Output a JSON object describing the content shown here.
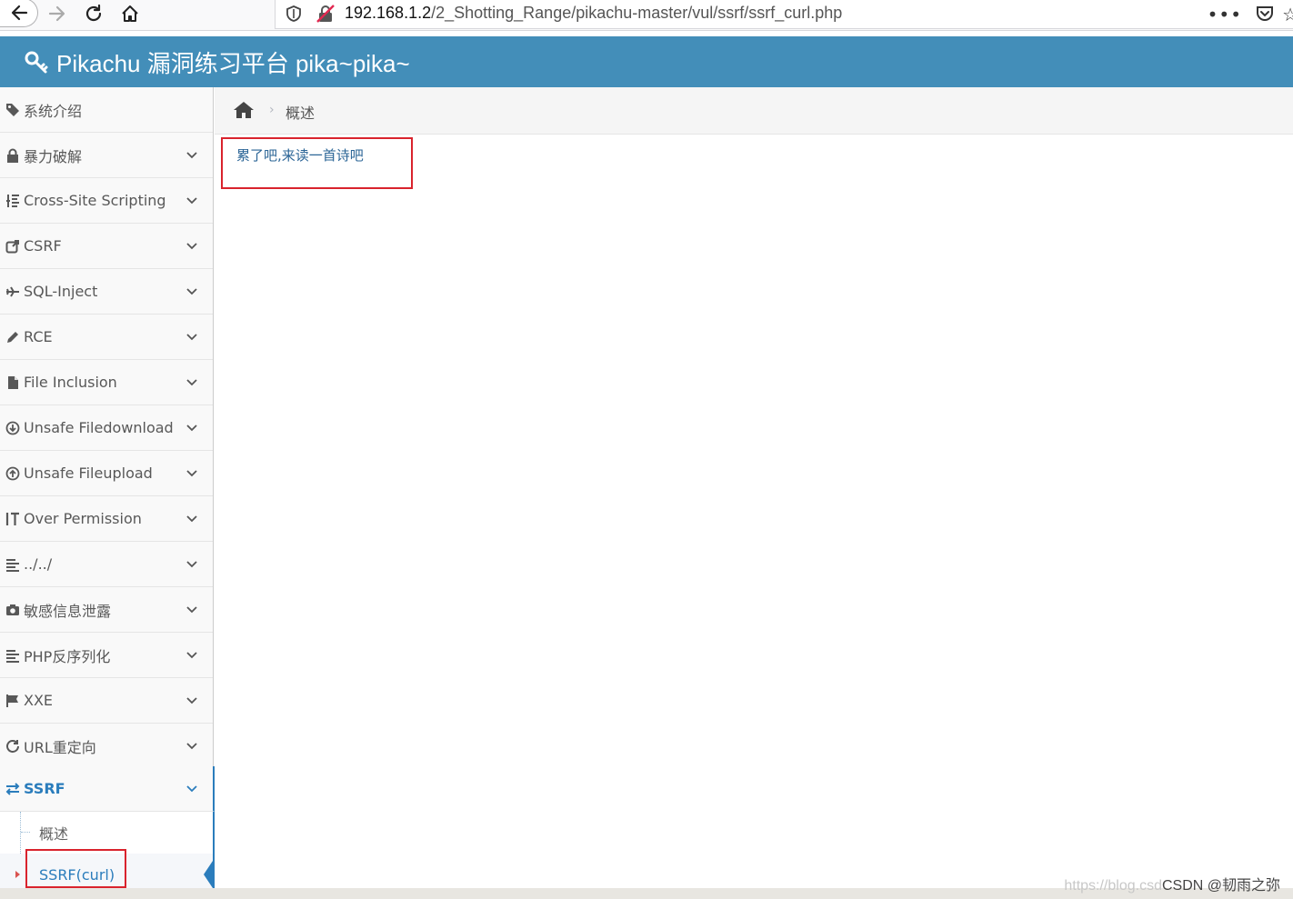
{
  "browser": {
    "url_host": "192.168.1.2",
    "url_path": "/2_Shotting_Range/pikachu-master/vul/ssrf/ssrf_curl.php",
    "more_label": "•••"
  },
  "header": {
    "title": "Pikachu 漏洞练习平台 pika~pika~"
  },
  "sidebar": {
    "items": [
      {
        "label": "系统介绍",
        "icon": "tag-icon"
      },
      {
        "label": "暴力破解",
        "icon": "lock-icon"
      },
      {
        "label": "Cross-Site Scripting",
        "icon": "list-tree-icon"
      },
      {
        "label": "CSRF",
        "icon": "share-icon"
      },
      {
        "label": "SQL-Inject",
        "icon": "plane-icon"
      },
      {
        "label": "RCE",
        "icon": "pencil-icon"
      },
      {
        "label": "File Inclusion",
        "icon": "file-icon"
      },
      {
        "label": "Unsafe Filedownload",
        "icon": "download-circle-icon"
      },
      {
        "label": "Unsafe Fileupload",
        "icon": "upload-circle-icon"
      },
      {
        "label": "Over Permission",
        "icon": "text-height-icon"
      },
      {
        "label": "../../",
        "icon": "align-left-icon"
      },
      {
        "label": "敏感信息泄露",
        "icon": "camera-icon"
      },
      {
        "label": "PHP反序列化",
        "icon": "align-left-icon"
      },
      {
        "label": "XXE",
        "icon": "flag-icon"
      },
      {
        "label": "URL重定向",
        "icon": "refresh-icon"
      },
      {
        "label": "SSRF",
        "icon": "exchange-icon"
      }
    ],
    "submenu": [
      {
        "label": "概述"
      },
      {
        "label": "SSRF(curl)"
      }
    ]
  },
  "breadcrumb": {
    "current": "概述",
    "separator": "›"
  },
  "main": {
    "poem_link": "累了吧,来读一首诗吧"
  },
  "watermark": {
    "faint": "https://blog.csd",
    "text": "CSDN @韧雨之弥"
  },
  "colors": {
    "header_bg": "#438eb9",
    "accent": "#2b7dbc",
    "highlight_box": "#d9232d"
  }
}
